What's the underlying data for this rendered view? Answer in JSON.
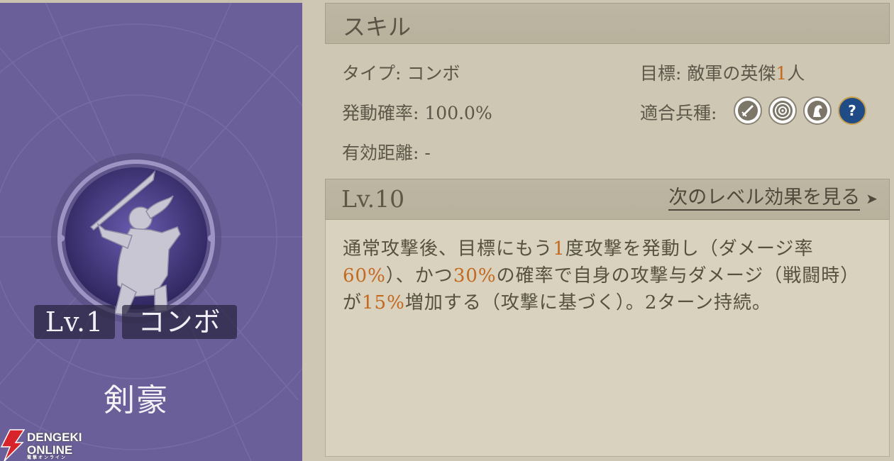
{
  "left_card": {
    "level_badge": "Lv.1",
    "type_badge": "コンボ",
    "skill_name": "剣豪"
  },
  "watermark": {
    "line1": "DENGEKI",
    "line2": "ONLINE",
    "line3": "電撃オンライン"
  },
  "skill_section": {
    "header": "スキル",
    "type_label": "タイプ:",
    "type_value": "コンボ",
    "target_label": "目標:",
    "target_value_prefix": "敵軍の英傑",
    "target_value_number": "1",
    "target_value_suffix": "人",
    "rate_label": "発動確率:",
    "rate_value": "100.0%",
    "units_label": "適合兵種:",
    "units": [
      "sword-unit-icon",
      "archer-target-icon",
      "cavalry-horse-icon",
      "unknown-question-icon"
    ],
    "range_label": "有効距離:",
    "range_value": "-"
  },
  "level_section": {
    "level": "Lv.10",
    "next_label": "次のレベル効果を見る",
    "next_arrow": "➤"
  },
  "effect": {
    "seg1": "通常攻撃後、目標にもう",
    "num1": "1",
    "seg2": "度攻撃を発動し（ダメージ率",
    "num2": "60%",
    "seg3": "）、かつ",
    "num3": "30%",
    "seg4": "の確率で自身の攻撃与ダメージ（戦闘時）が",
    "num4": "15%",
    "seg5": "増加する（攻撃に基づく）。2ターン持続。"
  },
  "colors": {
    "highlight": "#c4691e",
    "card_purple": "#6a5f98",
    "panel_beige": "#cdc7b3"
  }
}
